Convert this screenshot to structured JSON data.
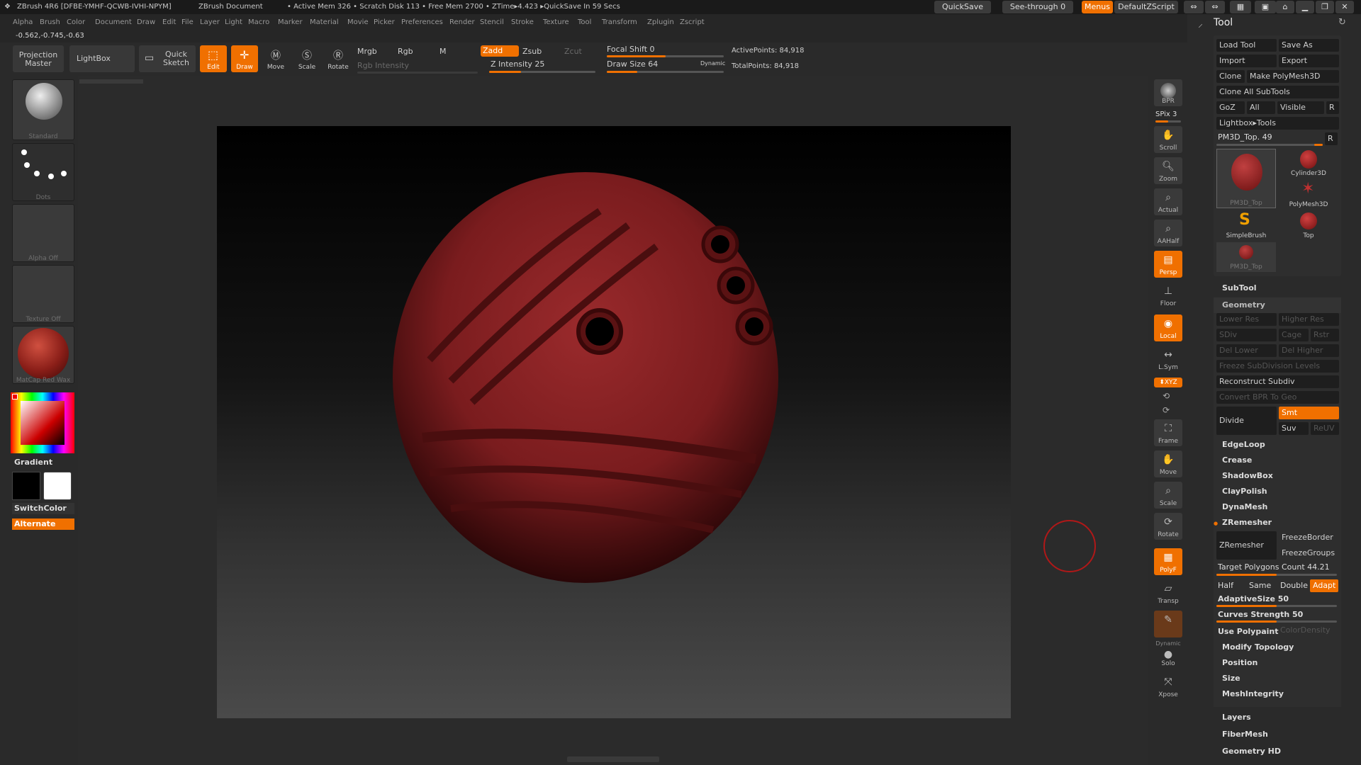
{
  "titlebar": {
    "app": "ZBrush 4R6 [DFBE-YMHF-QCWB-IVHI-NPYM]",
    "doc": "ZBrush Document",
    "stats": "• Active Mem 326 • Scratch Disk 113 • Free Mem 2700 • ZTime▸4.423 ▸QuickSave In 59 Secs",
    "quicksave": "QuickSave",
    "seethrough": "See-through  0",
    "menus": "Menus",
    "script": "DefaultZScript"
  },
  "menu": [
    "Alpha",
    "Brush",
    "Color",
    "Document",
    "Draw",
    "Edit",
    "File",
    "Layer",
    "Light",
    "Macro",
    "Marker",
    "Material",
    "Movie",
    "Picker",
    "Preferences",
    "Render",
    "Stencil",
    "Stroke",
    "Texture",
    "Tool",
    "Transform",
    "Zplugin",
    "Zscript"
  ],
  "coords": "-0.562,-0.745,-0.63",
  "toolbar": {
    "projection": "Projection Master",
    "lightbox": "LightBox",
    "quicksketch": "Quick Sketch",
    "edit": "Edit",
    "draw": "Draw",
    "move": "Move",
    "scale": "Scale",
    "rotate": "Rotate",
    "mrgb": "Mrgb",
    "rgb": "Rgb",
    "m": "M",
    "rgb_intensity": "Rgb Intensity",
    "zadd": "Zadd",
    "zsub": "Zsub",
    "zcut": "Zcut",
    "z_intensity": "Z Intensity 25",
    "focal_shift": "Focal Shift 0",
    "draw_size": "Draw Size 64",
    "dynamic": "Dynamic",
    "active_points": "ActivePoints: 84,918",
    "total_points": "TotalPoints: 84,918"
  },
  "left": {
    "brush": "Standard",
    "stroke": "Dots",
    "alpha": "Alpha Off",
    "texture": "Texture Off",
    "material": "MatCap Red Wax",
    "gradient": "Gradient",
    "switchcolor": "SwitchColor",
    "alternate": "Alternate"
  },
  "right": {
    "bpr": "BPR",
    "spix": "SPix 3",
    "scroll": "Scroll",
    "zoom": "Zoom",
    "actual": "Actual",
    "aahalf": "AAHalf",
    "persp": "Persp",
    "floor": "Floor",
    "local": "Local",
    "lsym": "L.Sym",
    "xyz": "⬍XYZ",
    "frame": "Frame",
    "move": "Move",
    "scale": "Scale",
    "rotate": "Rotate",
    "polyf": "PolyF",
    "transp": "Transp",
    "dynamic": "Dynamic",
    "solo": "Solo",
    "xpose": "Xpose"
  },
  "tool": {
    "title": "Tool",
    "load": "Load Tool",
    "saveas": "Save As",
    "import": "Import",
    "export": "Export",
    "clone": "Clone",
    "makepoly": "Make PolyMesh3D",
    "cloneall": "Clone All SubTools",
    "goz": "GoZ",
    "all": "All",
    "visible": "Visible",
    "r": "R",
    "lightboxtools": "Lightbox▸Tools",
    "pm3d": "PM3D_Top. 49",
    "thumbs": [
      "PM3D_Top",
      "Cylinder3D",
      "PolyMesh3D",
      "SimpleBrush",
      "Top",
      "PM3D_Top"
    ],
    "subtool": "SubTool",
    "geometry": "Geometry",
    "lowerres": "Lower Res",
    "higherres": "Higher Res",
    "sdiv": "SDiv",
    "cage": "Cage",
    "rstr": "Rstr",
    "dellower": "Del Lower",
    "delhigher": "Del Higher",
    "freeze": "Freeze SubDivision Levels",
    "reconstruct": "Reconstruct Subdiv",
    "convertbpr": "Convert BPR To Geo",
    "divide": "Divide",
    "smt": "Smt",
    "suv": "Suv",
    "reuv": "ReUV",
    "edgeloop": "EdgeLoop",
    "crease": "Crease",
    "shadowbox": "ShadowBox",
    "claypolish": "ClayPolish",
    "dynamesh": "DynaMesh",
    "zremesher_hdr": "ZRemesher",
    "zremesher": "ZRemesher",
    "freezeborder": "FreezeBorder",
    "freezegroups": "FreezeGroups",
    "targetpoly": "Target Polygons Count 44.21",
    "half": "Half",
    "same": "Same",
    "double": "Double",
    "adapt": "Adapt",
    "adaptivesize": "AdaptiveSize 50",
    "curvesstrength": "Curves Strength 50",
    "usepolypaint": "Use Polypaint",
    "colordensity": "ColorDensity",
    "modifytopology": "Modify Topology",
    "position": "Position",
    "size": "Size",
    "meshintegrity": "MeshIntegrity",
    "layers": "Layers",
    "fibermesh": "FiberMesh",
    "geometryhd": "Geometry HD"
  },
  "colors": {
    "accent": "#f07000",
    "model": "#8c2226"
  }
}
